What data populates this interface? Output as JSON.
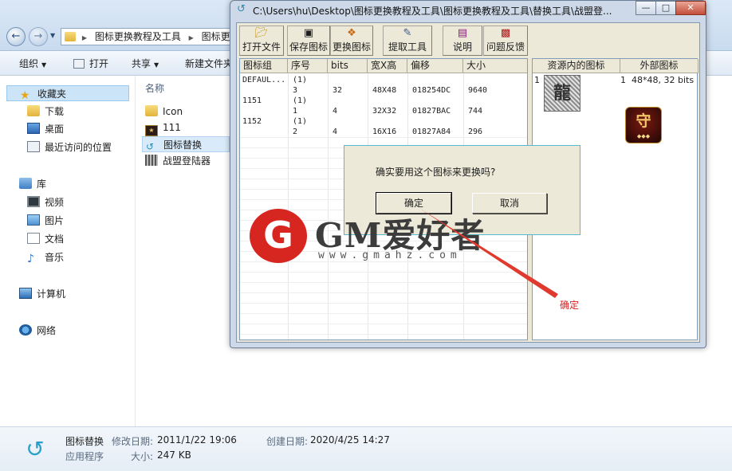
{
  "explorer": {
    "breadcrumb": [
      "图标更换教程及工具",
      "图标更"
    ],
    "toolbar": {
      "organize": "组织",
      "open": "打开",
      "share": "共享",
      "new_folder": "新建文件夹"
    },
    "nav": {
      "favorites": "收藏夹",
      "downloads": "下载",
      "desktop": "桌面",
      "recent": "最近访问的位置",
      "libraries": "库",
      "videos": "视频",
      "pictures": "图片",
      "documents": "文档",
      "music": "音乐",
      "computer": "计算机",
      "network": "网络"
    },
    "column_name": "名称",
    "files": [
      {
        "name": "Icon"
      },
      {
        "name": "111"
      },
      {
        "name": "图标替换"
      },
      {
        "name": "战盟登陆器"
      }
    ],
    "details": {
      "name": "图标替换",
      "type": "应用程序",
      "modified_label": "修改日期:",
      "modified": "2011/1/22 19:06",
      "size_label": "大小:",
      "size": "247 KB",
      "created_label": "创建日期:",
      "created": "2020/4/25 14:27"
    }
  },
  "window": {
    "title": "C:\\Users\\hu\\Desktop\\图标更换教程及工具\\图标更换教程及工具\\替换工具\\战盟登...",
    "buttons": {
      "open_file": "打开文件",
      "save_icon": "保存图标",
      "replace_icon": "更换图标",
      "extract_tool": "提取工具",
      "help": "说明",
      "feedback": "问题反馈"
    },
    "columns": [
      "图标组",
      "序号",
      "bits",
      "宽X高",
      "偏移",
      "大小"
    ],
    "rows": [
      [
        "DEFAUL...",
        "(1)",
        "",
        "",
        "",
        ""
      ],
      [
        "",
        "3",
        "32",
        "48X48",
        "018254DC",
        "9640"
      ],
      [
        "1151",
        "(1)",
        "",
        "",
        "",
        ""
      ],
      [
        "",
        "1",
        "4",
        "32X32",
        "01827BAC",
        "744"
      ],
      [
        "1152",
        "(1)",
        "",
        "",
        "",
        ""
      ],
      [
        "",
        "2",
        "4",
        "16X16",
        "01827A84",
        "296"
      ]
    ],
    "right_panel": {
      "col_internal": "资源内的图标",
      "col_external": "外部图标",
      "internal_index": "1",
      "external_index": "1",
      "external_info": "48*48, 32 bits"
    }
  },
  "dialog": {
    "message": "确实要用这个图标来更换吗?",
    "ok": "确定",
    "cancel": "取消"
  },
  "watermark": {
    "title": "GM爱好者",
    "url": "www.gmahz.com"
  },
  "annotation": "确定",
  "colors": {
    "annotation_red": "#d71f1f",
    "dialog_border": "#57b8d2",
    "logo_red": "#d7251f"
  }
}
